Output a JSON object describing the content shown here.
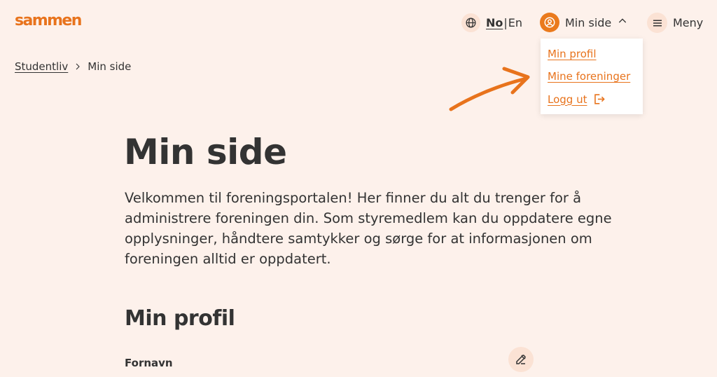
{
  "header": {
    "logo_text": "sammen",
    "lang_no": "No",
    "lang_sep": "|",
    "lang_en": "En",
    "minside_label": "Min side",
    "menu_label": "Meny"
  },
  "dropdown": {
    "items": [
      {
        "label": "Min profil"
      },
      {
        "label": "Mine foreninger"
      },
      {
        "label": "Logg ut"
      }
    ]
  },
  "breadcrumb": {
    "parent": "Studentliv",
    "current": "Min side"
  },
  "main": {
    "title": "Min side",
    "intro": "Velkommen til foreningsportalen! Her finner du alt du trenger for å administrere foreningen din. Som styremedlem kan du oppdatere egne opplysninger, håndtere samtykker og sørge for at informasjonen om foreningen alltid er oppdatert.",
    "profile_heading": "Min profil",
    "first_name_label": "Fornavn"
  },
  "colors": {
    "background": "#fdf1eb",
    "accent": "#e8731c",
    "text": "#333333",
    "icon_bg": "#fbe2d4"
  },
  "icons": [
    "globe-icon",
    "user-icon",
    "chevron-up-icon",
    "hamburger-icon",
    "logout-icon",
    "chevron-right-icon",
    "pencil-icon",
    "arrow-annotation"
  ]
}
